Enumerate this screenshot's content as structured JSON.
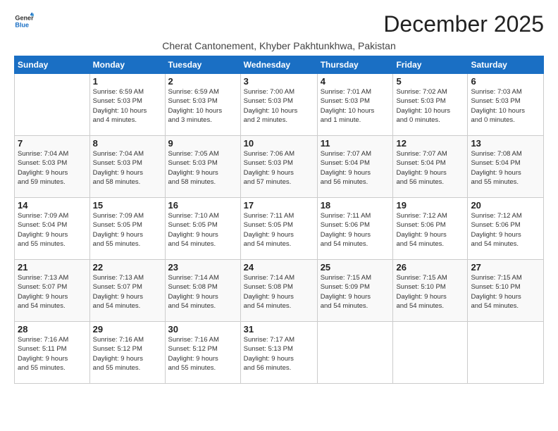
{
  "logo": {
    "line1": "General",
    "line2": "Blue"
  },
  "title": "December 2025",
  "subtitle": "Cherat Cantonement, Khyber Pakhtunkhwa, Pakistan",
  "days_of_week": [
    "Sunday",
    "Monday",
    "Tuesday",
    "Wednesday",
    "Thursday",
    "Friday",
    "Saturday"
  ],
  "weeks": [
    [
      {
        "day": "",
        "info": ""
      },
      {
        "day": "1",
        "info": "Sunrise: 6:59 AM\nSunset: 5:03 PM\nDaylight: 10 hours\nand 4 minutes."
      },
      {
        "day": "2",
        "info": "Sunrise: 6:59 AM\nSunset: 5:03 PM\nDaylight: 10 hours\nand 3 minutes."
      },
      {
        "day": "3",
        "info": "Sunrise: 7:00 AM\nSunset: 5:03 PM\nDaylight: 10 hours\nand 2 minutes."
      },
      {
        "day": "4",
        "info": "Sunrise: 7:01 AM\nSunset: 5:03 PM\nDaylight: 10 hours\nand 1 minute."
      },
      {
        "day": "5",
        "info": "Sunrise: 7:02 AM\nSunset: 5:03 PM\nDaylight: 10 hours\nand 0 minutes."
      },
      {
        "day": "6",
        "info": "Sunrise: 7:03 AM\nSunset: 5:03 PM\nDaylight: 10 hours\nand 0 minutes."
      }
    ],
    [
      {
        "day": "7",
        "info": "Sunrise: 7:04 AM\nSunset: 5:03 PM\nDaylight: 9 hours\nand 59 minutes."
      },
      {
        "day": "8",
        "info": "Sunrise: 7:04 AM\nSunset: 5:03 PM\nDaylight: 9 hours\nand 58 minutes."
      },
      {
        "day": "9",
        "info": "Sunrise: 7:05 AM\nSunset: 5:03 PM\nDaylight: 9 hours\nand 58 minutes."
      },
      {
        "day": "10",
        "info": "Sunrise: 7:06 AM\nSunset: 5:03 PM\nDaylight: 9 hours\nand 57 minutes."
      },
      {
        "day": "11",
        "info": "Sunrise: 7:07 AM\nSunset: 5:04 PM\nDaylight: 9 hours\nand 56 minutes."
      },
      {
        "day": "12",
        "info": "Sunrise: 7:07 AM\nSunset: 5:04 PM\nDaylight: 9 hours\nand 56 minutes."
      },
      {
        "day": "13",
        "info": "Sunrise: 7:08 AM\nSunset: 5:04 PM\nDaylight: 9 hours\nand 55 minutes."
      }
    ],
    [
      {
        "day": "14",
        "info": "Sunrise: 7:09 AM\nSunset: 5:04 PM\nDaylight: 9 hours\nand 55 minutes."
      },
      {
        "day": "15",
        "info": "Sunrise: 7:09 AM\nSunset: 5:05 PM\nDaylight: 9 hours\nand 55 minutes."
      },
      {
        "day": "16",
        "info": "Sunrise: 7:10 AM\nSunset: 5:05 PM\nDaylight: 9 hours\nand 54 minutes."
      },
      {
        "day": "17",
        "info": "Sunrise: 7:11 AM\nSunset: 5:05 PM\nDaylight: 9 hours\nand 54 minutes."
      },
      {
        "day": "18",
        "info": "Sunrise: 7:11 AM\nSunset: 5:06 PM\nDaylight: 9 hours\nand 54 minutes."
      },
      {
        "day": "19",
        "info": "Sunrise: 7:12 AM\nSunset: 5:06 PM\nDaylight: 9 hours\nand 54 minutes."
      },
      {
        "day": "20",
        "info": "Sunrise: 7:12 AM\nSunset: 5:06 PM\nDaylight: 9 hours\nand 54 minutes."
      }
    ],
    [
      {
        "day": "21",
        "info": "Sunrise: 7:13 AM\nSunset: 5:07 PM\nDaylight: 9 hours\nand 54 minutes."
      },
      {
        "day": "22",
        "info": "Sunrise: 7:13 AM\nSunset: 5:07 PM\nDaylight: 9 hours\nand 54 minutes."
      },
      {
        "day": "23",
        "info": "Sunrise: 7:14 AM\nSunset: 5:08 PM\nDaylight: 9 hours\nand 54 minutes."
      },
      {
        "day": "24",
        "info": "Sunrise: 7:14 AM\nSunset: 5:08 PM\nDaylight: 9 hours\nand 54 minutes."
      },
      {
        "day": "25",
        "info": "Sunrise: 7:15 AM\nSunset: 5:09 PM\nDaylight: 9 hours\nand 54 minutes."
      },
      {
        "day": "26",
        "info": "Sunrise: 7:15 AM\nSunset: 5:10 PM\nDaylight: 9 hours\nand 54 minutes."
      },
      {
        "day": "27",
        "info": "Sunrise: 7:15 AM\nSunset: 5:10 PM\nDaylight: 9 hours\nand 54 minutes."
      }
    ],
    [
      {
        "day": "28",
        "info": "Sunrise: 7:16 AM\nSunset: 5:11 PM\nDaylight: 9 hours\nand 55 minutes."
      },
      {
        "day": "29",
        "info": "Sunrise: 7:16 AM\nSunset: 5:12 PM\nDaylight: 9 hours\nand 55 minutes."
      },
      {
        "day": "30",
        "info": "Sunrise: 7:16 AM\nSunset: 5:12 PM\nDaylight: 9 hours\nand 55 minutes."
      },
      {
        "day": "31",
        "info": "Sunrise: 7:17 AM\nSunset: 5:13 PM\nDaylight: 9 hours\nand 56 minutes."
      },
      {
        "day": "",
        "info": ""
      },
      {
        "day": "",
        "info": ""
      },
      {
        "day": "",
        "info": ""
      }
    ]
  ]
}
